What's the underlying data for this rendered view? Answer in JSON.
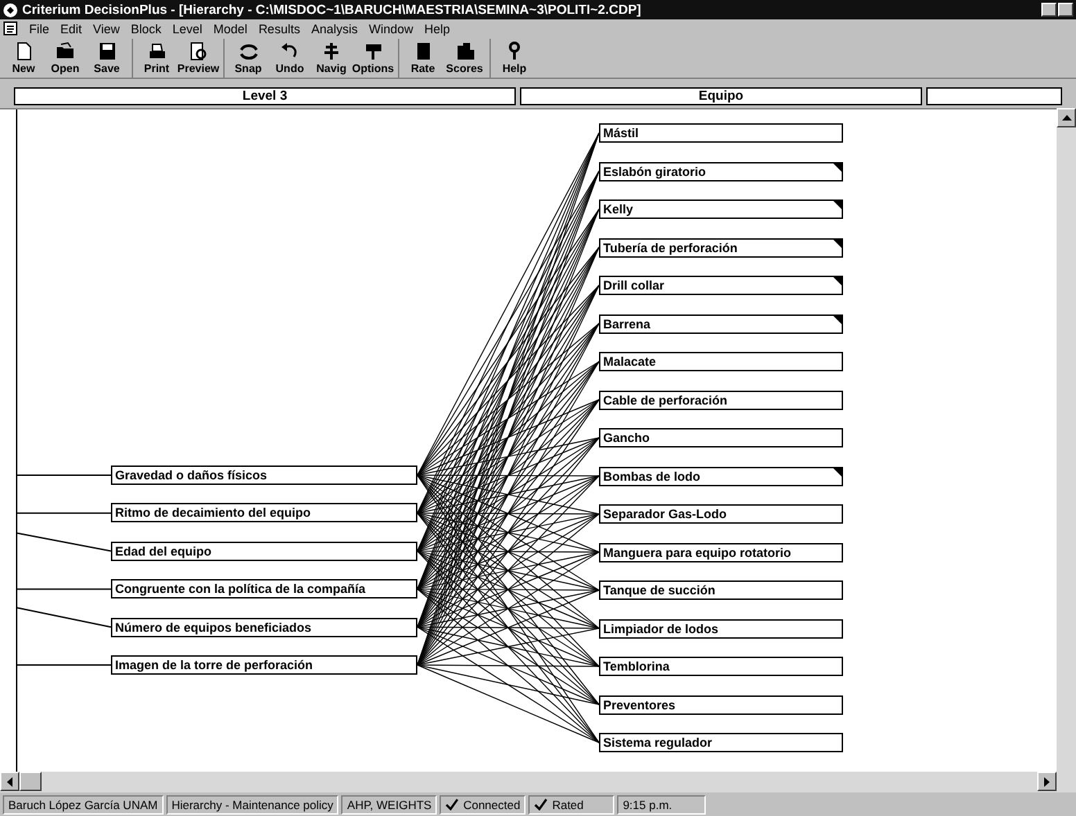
{
  "window": {
    "title": "Criterium DecisionPlus - [Hierarchy - C:\\MISDOC~1\\BARUCH\\MAESTRIA\\SEMINA~3\\POLITI~2.CDP]"
  },
  "menu": [
    "File",
    "Edit",
    "View",
    "Block",
    "Level",
    "Model",
    "Results",
    "Analysis",
    "Window",
    "Help"
  ],
  "toolbar": [
    {
      "group": [
        {
          "label": "New"
        },
        {
          "label": "Open"
        },
        {
          "label": "Save"
        }
      ]
    },
    {
      "group": [
        {
          "label": "Print"
        },
        {
          "label": "Preview"
        }
      ]
    },
    {
      "group": [
        {
          "label": "Snap"
        },
        {
          "label": "Undo"
        },
        {
          "label": "Navig"
        },
        {
          "label": "Options"
        }
      ]
    },
    {
      "group": [
        {
          "label": "Rate"
        },
        {
          "label": "Scores"
        }
      ]
    },
    {
      "group": [
        {
          "label": "Help"
        }
      ]
    }
  ],
  "level_headers": [
    "Level 3",
    "Equipo"
  ],
  "criteria": [
    {
      "label": "Gravedad o daños físicos"
    },
    {
      "label": "Ritmo de decaimiento del equipo"
    },
    {
      "label": "Edad del equipo"
    },
    {
      "label": "Congruente con la política de la compañía"
    },
    {
      "label": "Número de equipos beneficiados"
    },
    {
      "label": "Imagen de la torre de perforación"
    }
  ],
  "alternatives": [
    {
      "label": "Mástil",
      "marked": false
    },
    {
      "label": "Eslabón giratorio",
      "marked": true
    },
    {
      "label": "Kelly",
      "marked": true
    },
    {
      "label": "Tubería de perforación",
      "marked": true
    },
    {
      "label": "Drill collar",
      "marked": true
    },
    {
      "label": "Barrena",
      "marked": true
    },
    {
      "label": "Malacate",
      "marked": false
    },
    {
      "label": "Cable de perforación",
      "marked": false
    },
    {
      "label": "Gancho",
      "marked": false
    },
    {
      "label": "Bombas de lodo",
      "marked": true
    },
    {
      "label": "Separador Gas-Lodo",
      "marked": false
    },
    {
      "label": "Manguera para equipo rotatorio",
      "marked": false
    },
    {
      "label": "Tanque de succión",
      "marked": false
    },
    {
      "label": "Limpiador de lodos",
      "marked": false
    },
    {
      "label": "Temblorina",
      "marked": false
    },
    {
      "label": "Preventores",
      "marked": false
    },
    {
      "label": "Sistema regulador",
      "marked": false
    }
  ],
  "status_bar": [
    {
      "kind": "text",
      "text": "Baruch López García UNAM"
    },
    {
      "kind": "text",
      "text": "Hierarchy - Maintenance policy"
    },
    {
      "kind": "text",
      "text": "AHP, WEIGHTS"
    },
    {
      "kind": "check",
      "text": "Connected"
    },
    {
      "kind": "check",
      "text": "Rated"
    },
    {
      "kind": "text",
      "text": "9:15 p.m."
    }
  ]
}
